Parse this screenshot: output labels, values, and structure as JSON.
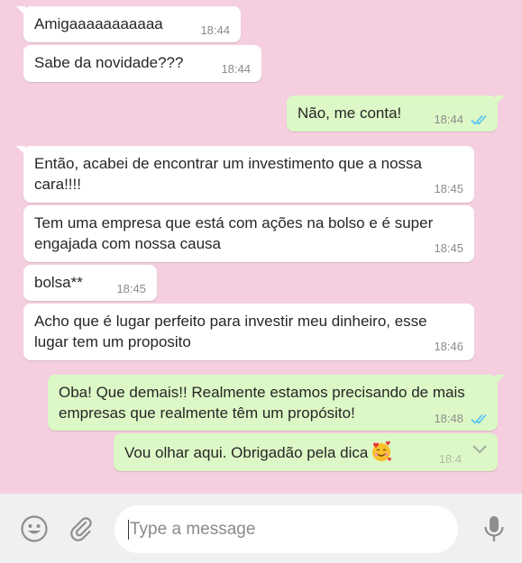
{
  "messages": [
    {
      "dir": "in",
      "text": "Amigaaaaaaaaaaa",
      "time": "18:44",
      "tail": true
    },
    {
      "dir": "in",
      "text": "Sabe da novidade???",
      "time": "18:44",
      "tail": false
    },
    {
      "dir": "out",
      "text": "Não, me conta!",
      "time": "18:44",
      "tail": true,
      "status": "read"
    },
    {
      "dir": "in",
      "text": "Então, acabei de encontrar um investimento que a nossa cara!!!!",
      "time": "18:45",
      "tail": true
    },
    {
      "dir": "in",
      "text": "Tem uma empresa que está com ações na bolso e é super engajada com nossa causa",
      "time": "18:45",
      "tail": false
    },
    {
      "dir": "in",
      "text": "bolsa**",
      "time": "18:45",
      "tail": false
    },
    {
      "dir": "in",
      "text": "Acho que é lugar perfeito para investir meu dinheiro, esse lugar tem um proposito",
      "time": "18:46",
      "tail": false
    },
    {
      "dir": "out",
      "text": "Oba! Que demais!! Realmente estamos precisando de mais empresas que realmente têm um propósito!",
      "time": "18:48",
      "tail": true,
      "status": "read"
    },
    {
      "dir": "out",
      "text": "Vou olhar aqui. Obrigadão pela dica",
      "time": "18:4",
      "tail": false,
      "emoji": "smiling-face-with-hearts"
    }
  ],
  "composer": {
    "placeholder": "Type a message",
    "emoji_icon": "emoji-icon",
    "attach_icon": "paperclip-icon",
    "mic_icon": "microphone-icon"
  },
  "colors": {
    "chat_background": "#f5cfe0",
    "incoming_bubble": "#ffffff",
    "outgoing_bubble": "#dcf8c6",
    "read_ticks": "#4fc3f7",
    "composer_bar": "#f0f0f0"
  }
}
